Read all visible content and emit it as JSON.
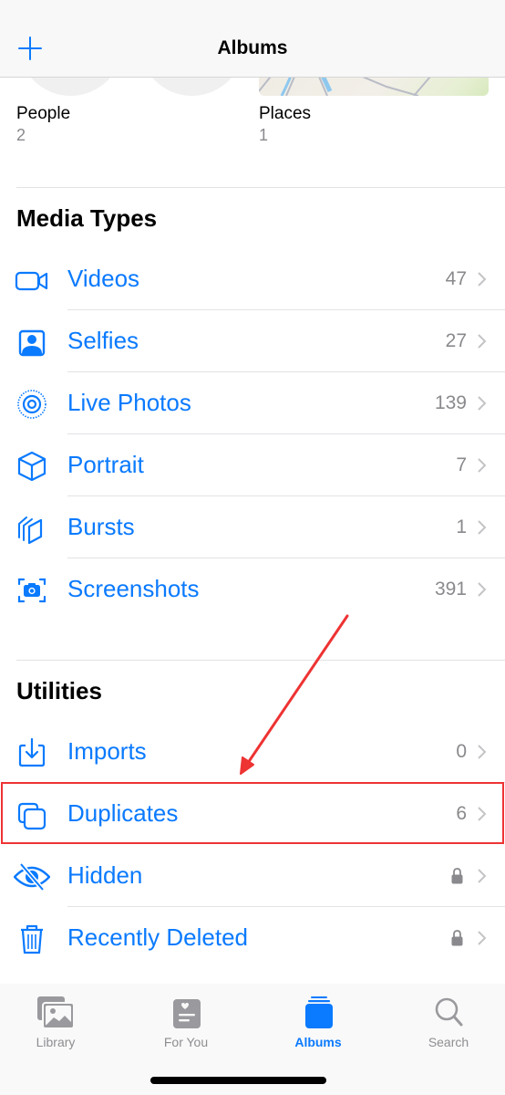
{
  "navbar": {
    "title": "Albums",
    "add_icon": "plus-icon"
  },
  "top_albums": [
    {
      "label": "People",
      "count": "2"
    },
    {
      "label": "Places",
      "count": "1"
    }
  ],
  "media_types": {
    "title": "Media Types",
    "items": [
      {
        "label": "Videos",
        "count": "47",
        "icon": "video-camera-icon"
      },
      {
        "label": "Selfies",
        "count": "27",
        "icon": "person-square-icon"
      },
      {
        "label": "Live Photos",
        "count": "139",
        "icon": "live-photo-icon"
      },
      {
        "label": "Portrait",
        "count": "7",
        "icon": "cube-icon"
      },
      {
        "label": "Bursts",
        "count": "1",
        "icon": "bursts-icon"
      },
      {
        "label": "Screenshots",
        "count": "391",
        "icon": "screenshot-camera-icon"
      }
    ]
  },
  "utilities": {
    "title": "Utilities",
    "items": [
      {
        "label": "Imports",
        "count": "0",
        "icon": "import-tray-icon"
      },
      {
        "label": "Duplicates",
        "count": "6",
        "icon": "duplicate-squares-icon",
        "highlighted": true
      },
      {
        "label": "Hidden",
        "count": "",
        "icon": "eye-slash-icon",
        "locked": true
      },
      {
        "label": "Recently Deleted",
        "count": "",
        "icon": "trash-icon",
        "locked": true
      }
    ]
  },
  "tabbar": {
    "tabs": [
      {
        "label": "Library",
        "icon": "photo-library-icon",
        "active": false
      },
      {
        "label": "For You",
        "icon": "for-you-icon",
        "active": false
      },
      {
        "label": "Albums",
        "icon": "albums-stack-icon",
        "active": true
      },
      {
        "label": "Search",
        "icon": "magnifier-icon",
        "active": false
      }
    ]
  },
  "colors": {
    "accent": "#0a7aff",
    "secondary_text": "#8a8a8e",
    "annotation": "#ee3333"
  }
}
